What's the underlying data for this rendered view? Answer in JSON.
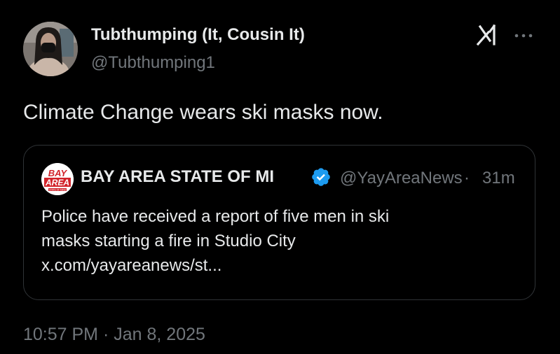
{
  "author": {
    "name": "Tubthumping (It, Cousin It)",
    "handle": "@Tubthumping1"
  },
  "icons": {
    "grok": "grok-icon",
    "more": "more-dots-icon",
    "verified": "verified-badge-icon"
  },
  "tweet": {
    "text": "Climate Change wears ski masks now.",
    "time": "10:57 PM",
    "separator": "·",
    "date": "Jan 8, 2025"
  },
  "quote": {
    "avatar_logo_line1": "BAY",
    "avatar_logo_line2": "AREA",
    "avatar_logo_line3": "STATE OF MIND",
    "name": "BAY AREA STATE OF MI",
    "handle": "@YayAreaNews",
    "separator": "·",
    "time": "31m",
    "lines": [
      "Police have received a report of five men in ski",
      "masks starting a fire in Studio City",
      "x.com/yayareanews/st..."
    ]
  },
  "colors": {
    "background": "#000000",
    "text_primary": "#e7e9ea",
    "text_secondary": "#71767b",
    "border": "#2f3336",
    "verified_blue": "#1d9bf0",
    "logo_red": "#d2232a"
  }
}
